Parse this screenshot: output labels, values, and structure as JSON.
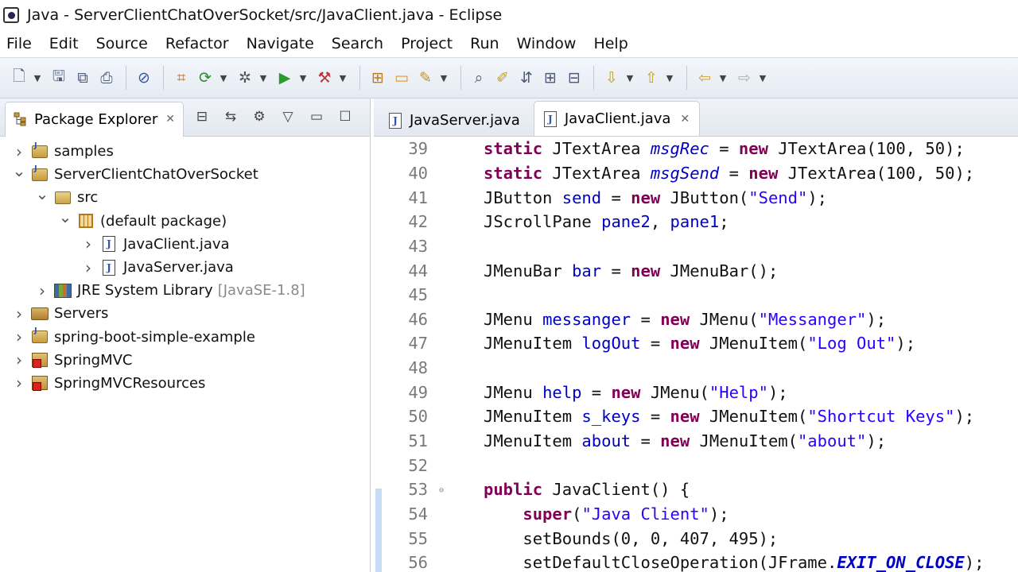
{
  "window": {
    "title": "Java - ServerClientChatOverSocket/src/JavaClient.java - Eclipse"
  },
  "menubar": [
    "File",
    "Edit",
    "Source",
    "Refactor",
    "Navigate",
    "Search",
    "Project",
    "Run",
    "Window",
    "Help"
  ],
  "toolbar": {
    "icons": [
      "new-icon",
      "save-icon",
      "save-all-icon",
      "print-icon",
      "skip-breakpoints-icon",
      "build-icon",
      "refresh-icon",
      "debug-icon",
      "run-icon",
      "external-tools-icon",
      "new-package-icon",
      "open-folder-icon",
      "link-icon",
      "open-type-icon",
      "highlight-icon",
      "toggle-icon",
      "expand-icon",
      "collapse-icon",
      "next-annotation-icon",
      "prev-annotation-icon",
      "back-icon",
      "forward-icon"
    ]
  },
  "package_explorer": {
    "tab_label": "Package Explorer",
    "tree": [
      {
        "label": "samples",
        "deco": "",
        "depth": 0,
        "expanded": false,
        "icon": "project-icon"
      },
      {
        "label": "ServerClientChatOverSocket",
        "deco": "",
        "depth": 0,
        "expanded": true,
        "icon": "project-icon"
      },
      {
        "label": "src",
        "deco": "",
        "depth": 1,
        "expanded": true,
        "icon": "source-folder-icon"
      },
      {
        "label": "(default package)",
        "deco": "",
        "depth": 2,
        "expanded": true,
        "icon": "package-icon"
      },
      {
        "label": "JavaClient.java",
        "deco": "",
        "depth": 3,
        "expanded": false,
        "icon": "java-file-icon"
      },
      {
        "label": "JavaServer.java",
        "deco": "",
        "depth": 3,
        "expanded": false,
        "icon": "java-file-icon"
      },
      {
        "label": "JRE System Library",
        "deco": "[JavaSE-1.8]",
        "depth": 1,
        "expanded": false,
        "icon": "library-icon"
      },
      {
        "label": "Servers",
        "deco": "",
        "depth": 0,
        "expanded": false,
        "icon": "server-icon"
      },
      {
        "label": "spring-boot-simple-example",
        "deco": "",
        "depth": 0,
        "expanded": false,
        "icon": "project-icon"
      },
      {
        "label": "SpringMVC",
        "deco": "",
        "depth": 0,
        "expanded": false,
        "icon": "spring-project-icon"
      },
      {
        "label": "SpringMVCResources",
        "deco": "",
        "depth": 0,
        "expanded": false,
        "icon": "spring-project-icon"
      }
    ]
  },
  "editor": {
    "tabs": [
      {
        "label": "JavaServer.java",
        "active": false
      },
      {
        "label": "JavaClient.java",
        "active": true
      }
    ],
    "lines": [
      {
        "n": "39",
        "tokens": [
          [
            "kw",
            "static"
          ],
          [
            "t",
            " JTextArea "
          ],
          [
            "sfld",
            "msgRec"
          ],
          [
            "t",
            " = "
          ],
          [
            "kw",
            "new"
          ],
          [
            "t",
            " JTextArea(100, 50);"
          ]
        ]
      },
      {
        "n": "40",
        "tokens": [
          [
            "kw",
            "static"
          ],
          [
            "t",
            " JTextArea "
          ],
          [
            "sfld",
            "msgSend"
          ],
          [
            "t",
            " = "
          ],
          [
            "kw",
            "new"
          ],
          [
            "t",
            " JTextArea(100, 50);"
          ]
        ]
      },
      {
        "n": "41",
        "tokens": [
          [
            "t",
            "JButton "
          ],
          [
            "fld",
            "send"
          ],
          [
            "t",
            " = "
          ],
          [
            "kw",
            "new"
          ],
          [
            "t",
            " JButton("
          ],
          [
            "str",
            "\"Send\""
          ],
          [
            "t",
            ");"
          ]
        ]
      },
      {
        "n": "42",
        "tokens": [
          [
            "t",
            "JScrollPane "
          ],
          [
            "fld",
            "pane2"
          ],
          [
            "t",
            ", "
          ],
          [
            "fld",
            "pane1"
          ],
          [
            "t",
            ";"
          ]
        ]
      },
      {
        "n": "43",
        "tokens": []
      },
      {
        "n": "44",
        "tokens": [
          [
            "t",
            "JMenuBar "
          ],
          [
            "fld",
            "bar"
          ],
          [
            "t",
            " = "
          ],
          [
            "kw",
            "new"
          ],
          [
            "t",
            " JMenuBar();"
          ]
        ]
      },
      {
        "n": "45",
        "tokens": []
      },
      {
        "n": "46",
        "tokens": [
          [
            "t",
            "JMenu "
          ],
          [
            "fld",
            "messanger"
          ],
          [
            "t",
            " = "
          ],
          [
            "kw",
            "new"
          ],
          [
            "t",
            " JMenu("
          ],
          [
            "str",
            "\"Messanger\""
          ],
          [
            "t",
            ");"
          ]
        ]
      },
      {
        "n": "47",
        "tokens": [
          [
            "t",
            "JMenuItem "
          ],
          [
            "fld",
            "logOut"
          ],
          [
            "t",
            " = "
          ],
          [
            "kw",
            "new"
          ],
          [
            "t",
            " JMenuItem("
          ],
          [
            "str",
            "\"Log Out\""
          ],
          [
            "t",
            ");"
          ]
        ]
      },
      {
        "n": "48",
        "tokens": []
      },
      {
        "n": "49",
        "tokens": [
          [
            "t",
            "JMenu "
          ],
          [
            "fld",
            "help"
          ],
          [
            "t",
            " = "
          ],
          [
            "kw",
            "new"
          ],
          [
            "t",
            " JMenu("
          ],
          [
            "str",
            "\"Help\""
          ],
          [
            "t",
            ");"
          ]
        ]
      },
      {
        "n": "50",
        "tokens": [
          [
            "t",
            "JMenuItem "
          ],
          [
            "fld",
            "s_keys"
          ],
          [
            "t",
            " = "
          ],
          [
            "kw",
            "new"
          ],
          [
            "t",
            " JMenuItem("
          ],
          [
            "str",
            "\"Shortcut Keys\""
          ],
          [
            "t",
            ");"
          ]
        ]
      },
      {
        "n": "51",
        "tokens": [
          [
            "t",
            "JMenuItem "
          ],
          [
            "fld",
            "about"
          ],
          [
            "t",
            " = "
          ],
          [
            "kw",
            "new"
          ],
          [
            "t",
            " JMenuItem("
          ],
          [
            "str",
            "\"about\""
          ],
          [
            "t",
            ");"
          ]
        ]
      },
      {
        "n": "52",
        "tokens": []
      },
      {
        "n": "53",
        "fold": true,
        "tokens": [
          [
            "kw",
            "public"
          ],
          [
            "t",
            " JavaClient() {"
          ]
        ]
      },
      {
        "n": "54",
        "tokens": [
          [
            "t",
            "    "
          ],
          [
            "kw",
            "super"
          ],
          [
            "t",
            "("
          ],
          [
            "str",
            "\"Java Client\""
          ],
          [
            "t",
            ");"
          ]
        ]
      },
      {
        "n": "55",
        "tokens": [
          [
            "t",
            "    setBounds(0, 0, 407, 495);"
          ]
        ]
      },
      {
        "n": "56",
        "tokens": [
          [
            "t",
            "    setDefaultCloseOperation(JFrame."
          ],
          [
            "cst",
            "EXIT_ON_CLOSE"
          ],
          [
            "t",
            ");"
          ]
        ]
      }
    ]
  }
}
